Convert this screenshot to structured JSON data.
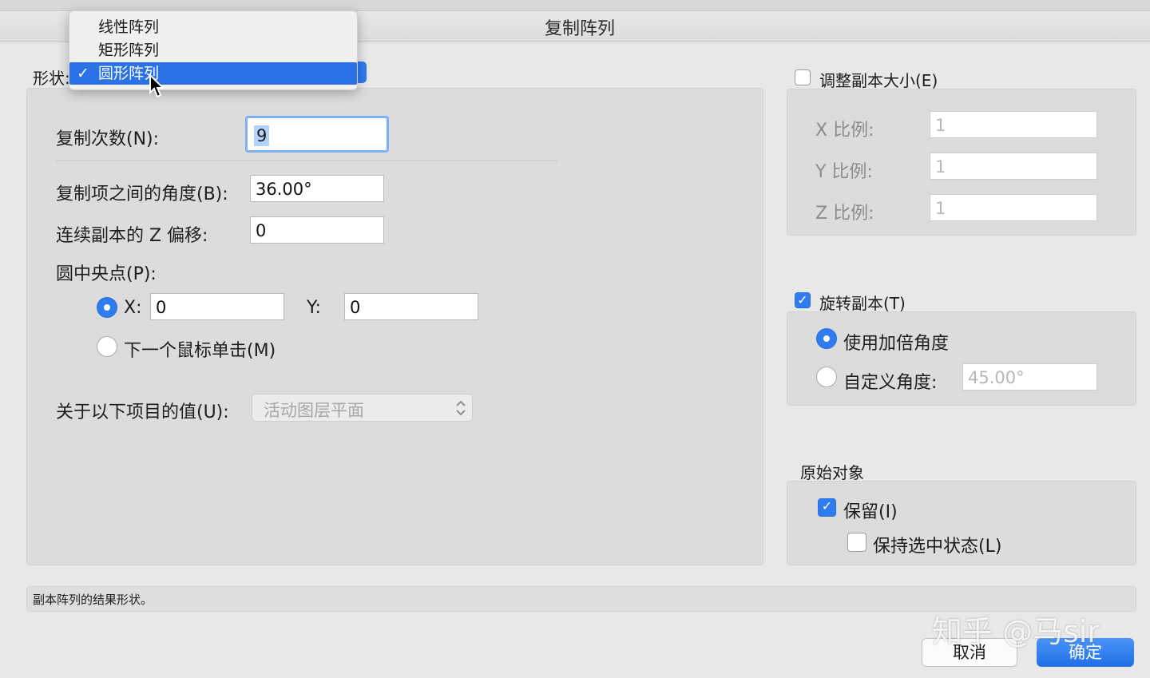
{
  "window": {
    "title": "复制阵列"
  },
  "shape": {
    "label": "形状:",
    "menu": [
      "线性阵列",
      "矩形阵列",
      "圆形阵列"
    ],
    "selected": "圆形阵列",
    "check_mark": "✓"
  },
  "left": {
    "copies_label": "复制次数(N):",
    "copies_value": "9",
    "angle_label": "复制项之间的角度(B):",
    "angle_value": "36.00°",
    "zoffset_label": "连续副本的 Z 偏移:",
    "zoffset_value": "0",
    "center_label": "圆中央点(P):",
    "x_label": "X:",
    "x_value": "0",
    "y_label": "Y:",
    "y_value": "0",
    "next_click_label": "下一个鼠标单击(M)",
    "relative_label": "关于以下项目的值(U):",
    "relative_value": "活动图层平面"
  },
  "resize": {
    "label": "调整副本大小(E)",
    "x_label": "X 比例:",
    "x_value": "1",
    "y_label": "Y 比例:",
    "y_value": "1",
    "z_label": "Z 比例:",
    "z_value": "1"
  },
  "rotate": {
    "label": "旋转副本(T)",
    "multiply_label": "使用加倍角度",
    "custom_label": "自定义角度:",
    "custom_value": "45.00°"
  },
  "original": {
    "heading": "原始对象",
    "keep_label": "保留(I)",
    "keep_selected_label": "保持选中状态(L)"
  },
  "status": "副本阵列的结果形状。",
  "buttons": {
    "cancel": "取消",
    "ok": "确定"
  },
  "watermark": "知乎 @马sir",
  "colors": {
    "accent": "#2f7bf0",
    "menu_highlight": "#2a72e6"
  }
}
